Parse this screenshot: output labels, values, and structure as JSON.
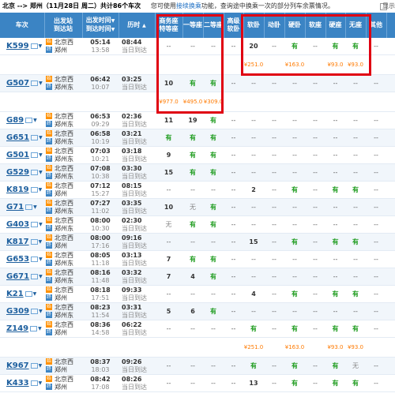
{
  "header": {
    "route": "北京 --> 郑州（11月28日  周二）共计",
    "count": "86",
    "count_suffix": "个车次",
    "hint_pre": "您可使用",
    "hint_link": "接续换乘",
    "hint_post": "功能，查询途中换乘一次的部分列车余票情况。",
    "more": "显示"
  },
  "columns": {
    "train": "车次",
    "stations": [
      "出发站",
      "到达站"
    ],
    "times": [
      "出发时间",
      "到达时间"
    ],
    "duration": "历时",
    "business": [
      "商务座",
      "特等座"
    ],
    "first": "一等座",
    "second": "二等座",
    "adv_soft": [
      "高级",
      "软卧"
    ],
    "soft_sleeper": "软卧",
    "moving_sleeper": "动卧",
    "hard_sleeper": "硬卧",
    "soft_seat": "软座",
    "hard_seat": "硬座",
    "no_seat": "无座",
    "other": "其他"
  },
  "rows": [
    {
      "type": "train",
      "no": "K599",
      "from": "北京西",
      "to": "郑州",
      "dep": "05:14",
      "arr": "13:58",
      "dur": "08:44",
      "note": "当日到达",
      "cells": [
        "--",
        "--",
        "--",
        "--",
        "20",
        "--",
        "有",
        "--",
        "有",
        "有",
        "--"
      ]
    },
    {
      "type": "price",
      "cells": [
        "",
        "",
        "",
        "",
        "¥251.0",
        "",
        "¥163.0",
        "",
        "¥93.0",
        "¥93.0",
        ""
      ]
    },
    {
      "type": "train",
      "no": "G507",
      "from": "北京西",
      "to": "郑州东",
      "dep": "06:42",
      "arr": "10:07",
      "dur": "03:25",
      "note": "当日到达",
      "cells": [
        "10",
        "有",
        "有",
        "--",
        "--",
        "--",
        "--",
        "--",
        "--",
        "--",
        "--"
      ]
    },
    {
      "type": "price",
      "cells": [
        "¥977.0",
        "¥495.0",
        "¥309.0",
        "",
        "",
        "",
        "",
        "",
        "",
        "",
        ""
      ]
    },
    {
      "type": "train",
      "no": "G89",
      "from": "北京西",
      "to": "郑州东",
      "dep": "06:53",
      "arr": "09:29",
      "dur": "02:36",
      "note": "当日到达",
      "cells": [
        "11",
        "19",
        "有",
        "--",
        "--",
        "--",
        "--",
        "--",
        "--",
        "--",
        "--"
      ]
    },
    {
      "type": "train",
      "no": "G651",
      "from": "北京西",
      "to": "郑州东",
      "dep": "06:58",
      "arr": "10:19",
      "dur": "03:21",
      "note": "当日到达",
      "cells": [
        "有",
        "有",
        "有",
        "--",
        "--",
        "--",
        "--",
        "--",
        "--",
        "--",
        "--"
      ]
    },
    {
      "type": "train",
      "no": "G501",
      "from": "北京西",
      "to": "郑州东",
      "dep": "07:03",
      "arr": "10:21",
      "dur": "03:18",
      "note": "当日到达",
      "cells": [
        "9",
        "有",
        "有",
        "--",
        "--",
        "--",
        "--",
        "--",
        "--",
        "--",
        "--"
      ]
    },
    {
      "type": "train",
      "no": "G529",
      "from": "北京西",
      "to": "郑州东",
      "dep": "07:08",
      "arr": "10:38",
      "dur": "03:30",
      "note": "当日到达",
      "cells": [
        "15",
        "有",
        "有",
        "--",
        "--",
        "--",
        "--",
        "--",
        "--",
        "--",
        "--"
      ]
    },
    {
      "type": "train",
      "no": "K819",
      "from": "北京西",
      "to": "郑州",
      "dep": "07:12",
      "arr": "15:27",
      "dur": "08:15",
      "note": "当日到达",
      "cells": [
        "--",
        "--",
        "--",
        "--",
        "2",
        "--",
        "有",
        "--",
        "有",
        "有",
        "--"
      ]
    },
    {
      "type": "train",
      "no": "G71",
      "from": "北京西",
      "to": "郑州东",
      "dep": "07:27",
      "arr": "11:02",
      "dur": "03:35",
      "note": "当日到达",
      "cells": [
        "10",
        "无",
        "有",
        "--",
        "--",
        "--",
        "--",
        "--",
        "--",
        "--",
        "--"
      ]
    },
    {
      "type": "train",
      "no": "G403",
      "from": "北京西",
      "to": "郑州东",
      "dep": "08:00",
      "arr": "10:30",
      "dur": "02:30",
      "note": "当日到达",
      "cells": [
        "无",
        "有",
        "有",
        "--",
        "--",
        "--",
        "--",
        "--",
        "--",
        "--",
        "--"
      ]
    },
    {
      "type": "train",
      "no": "K817",
      "from": "北京西",
      "to": "郑州",
      "dep": "08:00",
      "arr": "17:16",
      "dur": "09:16",
      "note": "当日到达",
      "cells": [
        "--",
        "--",
        "--",
        "--",
        "15",
        "--",
        "有",
        "--",
        "有",
        "有",
        "--"
      ]
    },
    {
      "type": "train",
      "no": "G653",
      "from": "北京西",
      "to": "郑州东",
      "dep": "08:05",
      "arr": "11:18",
      "dur": "03:13",
      "note": "当日到达",
      "cells": [
        "7",
        "有",
        "有",
        "--",
        "--",
        "--",
        "--",
        "--",
        "--",
        "--",
        "--"
      ]
    },
    {
      "type": "train",
      "no": "G671",
      "from": "北京西",
      "to": "郑州东",
      "dep": "08:16",
      "arr": "11:48",
      "dur": "03:32",
      "note": "当日到达",
      "cells": [
        "7",
        "4",
        "有",
        "--",
        "--",
        "--",
        "--",
        "--",
        "--",
        "--",
        "--"
      ]
    },
    {
      "type": "train",
      "no": "K21",
      "from": "北京西",
      "to": "郑州",
      "dep": "08:18",
      "arr": "17:51",
      "dur": "09:33",
      "note": "当日到达",
      "cells": [
        "--",
        "--",
        "--",
        "--",
        "4",
        "--",
        "有",
        "--",
        "有",
        "有",
        "--"
      ]
    },
    {
      "type": "train",
      "no": "G309",
      "from": "北京西",
      "to": "郑州东",
      "dep": "08:23",
      "arr": "11:54",
      "dur": "03:31",
      "note": "当日到达",
      "cells": [
        "5",
        "6",
        "有",
        "--",
        "--",
        "--",
        "--",
        "--",
        "--",
        "--",
        "--"
      ]
    },
    {
      "type": "train",
      "no": "Z149",
      "from": "北京西",
      "to": "郑州",
      "dep": "08:36",
      "arr": "14:58",
      "dur": "06:22",
      "note": "当日到达",
      "cells": [
        "--",
        "--",
        "--",
        "--",
        "有",
        "--",
        "有",
        "--",
        "有",
        "有",
        "--"
      ]
    },
    {
      "type": "price",
      "cells": [
        "",
        "",
        "",
        "",
        "¥251.0",
        "",
        "¥163.0",
        "",
        "¥93.0",
        "¥93.0",
        ""
      ]
    },
    {
      "type": "train",
      "no": "K967",
      "from": "北京西",
      "to": "郑州",
      "dep": "08:37",
      "arr": "18:03",
      "dur": "09:26",
      "note": "当日到达",
      "cells": [
        "--",
        "--",
        "--",
        "--",
        "有",
        "--",
        "有",
        "--",
        "有",
        "无",
        "--"
      ]
    },
    {
      "type": "train",
      "no": "K433",
      "from": "北京西",
      "to": "郑州",
      "dep": "08:42",
      "arr": "17:08",
      "dur": "08:26",
      "note": "当日到达",
      "cells": [
        "--",
        "--",
        "--",
        "--",
        "13",
        "--",
        "有",
        "--",
        "有",
        "有",
        "--"
      ]
    }
  ]
}
